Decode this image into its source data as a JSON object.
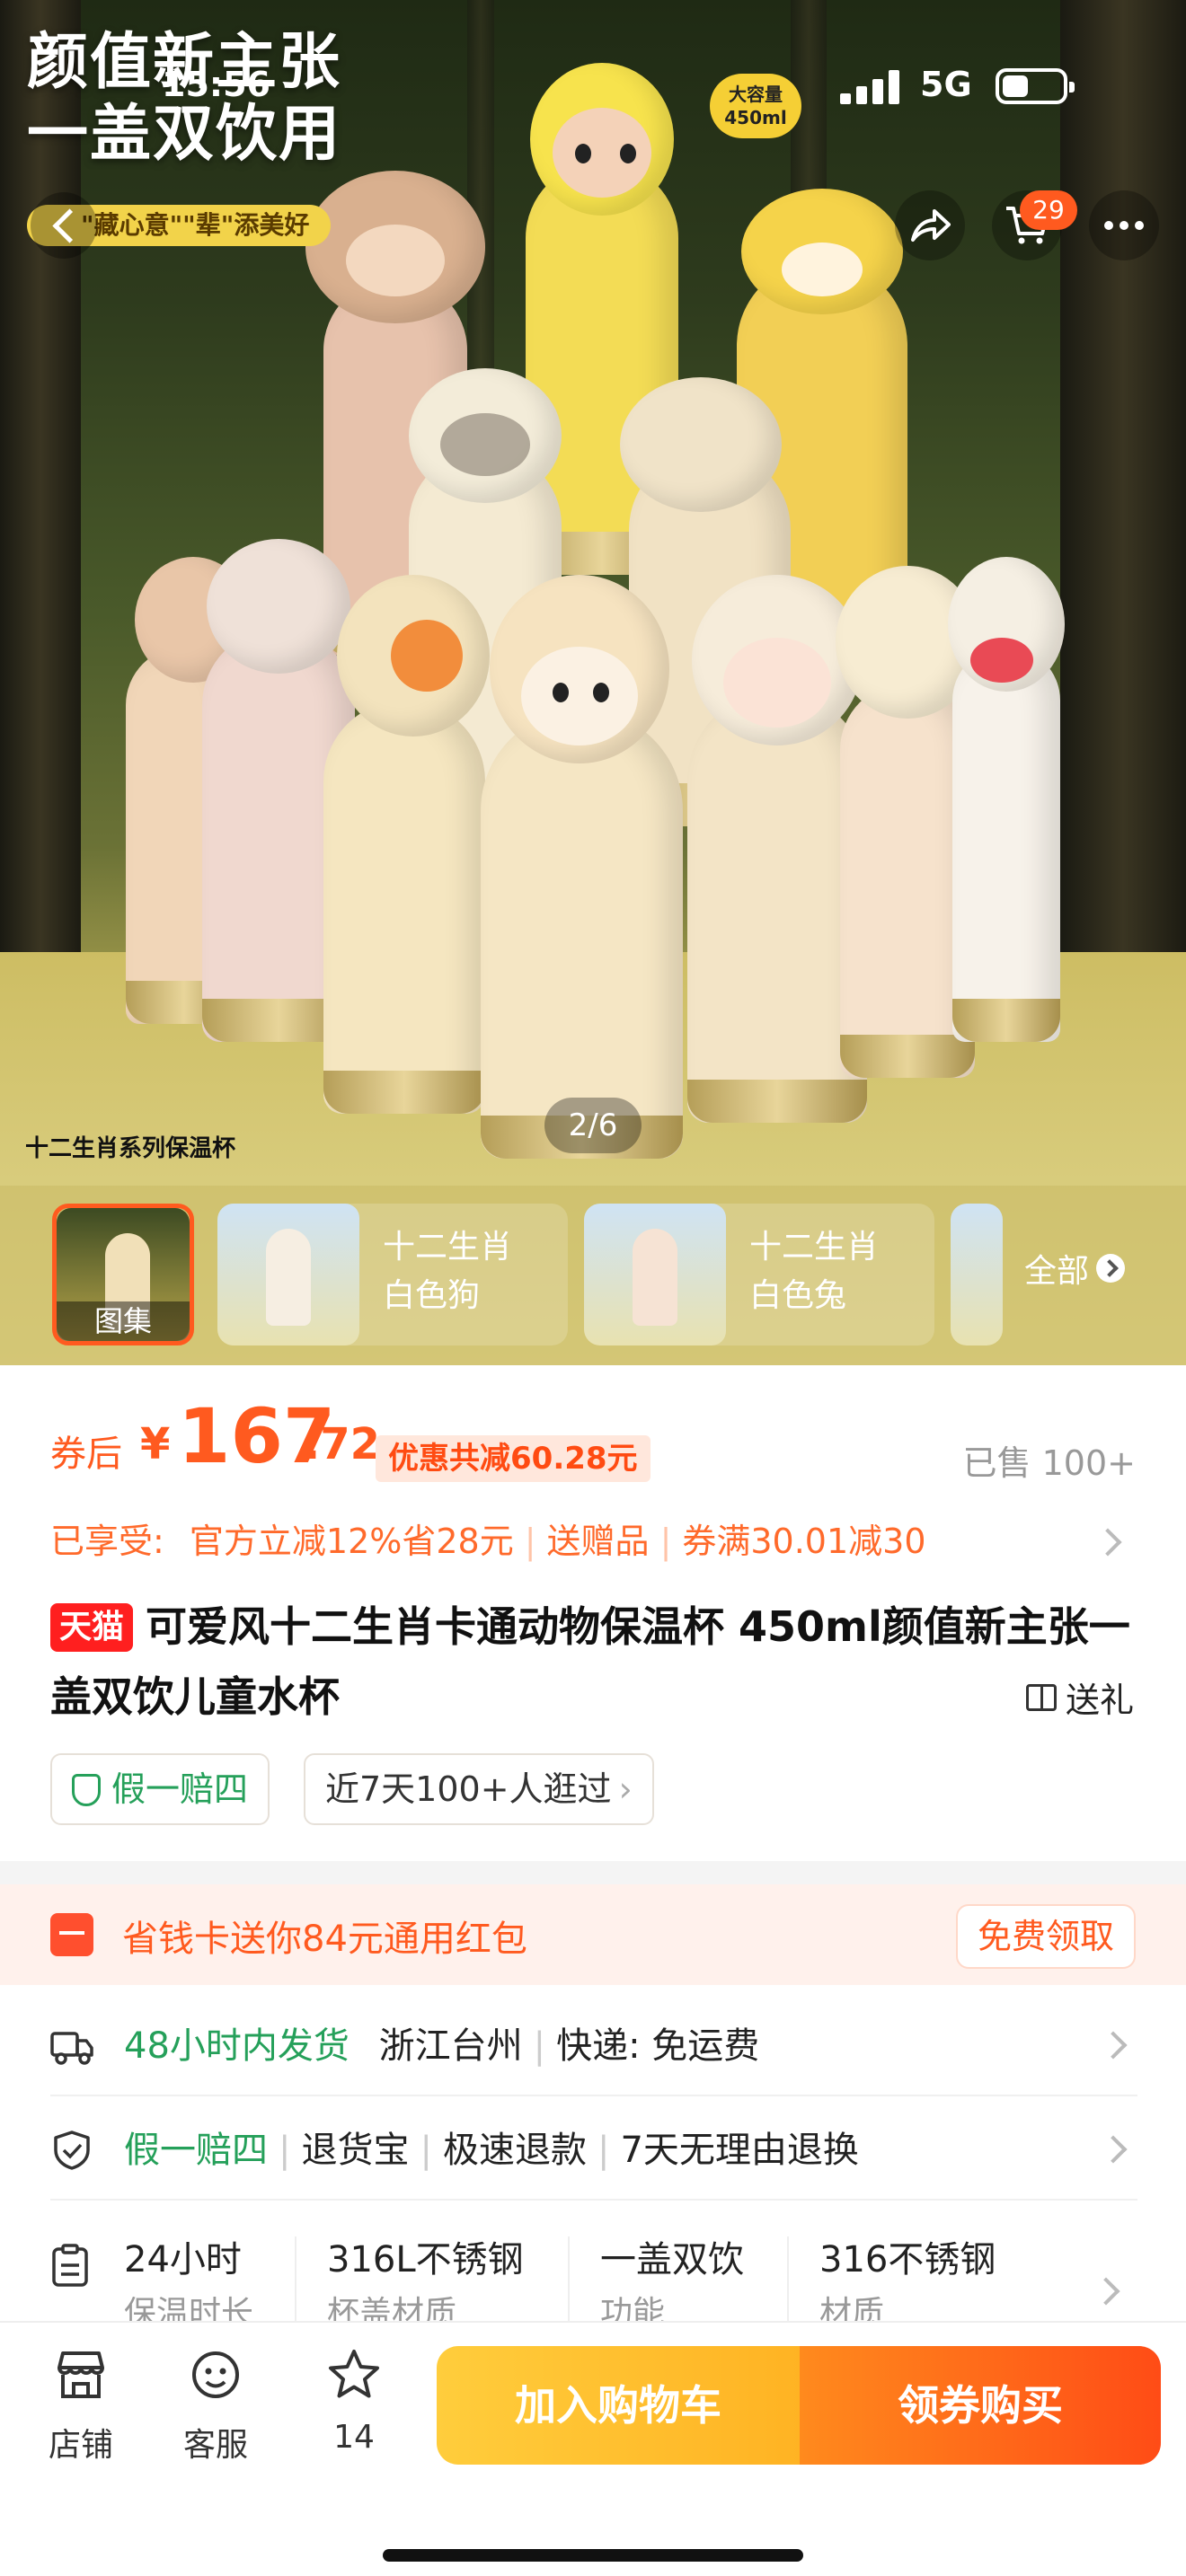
{
  "status_bar": {
    "time": "15:56",
    "network": "5G"
  },
  "hero": {
    "title_line1": "颜值新主张",
    "title_line2": "一盖双饮用",
    "slogan": "\"藏心意\"\"辈\"添美好",
    "capacity_badge_line1": "大容量",
    "capacity_badge_line2": "450ml",
    "footer_caption": "十二生肖系列保温杯",
    "pager": "2/6",
    "cart_count": "29"
  },
  "thumbnails": [
    {
      "label": "图集",
      "selected": true
    },
    {
      "line1": "十二生肖",
      "line2": "白色狗"
    },
    {
      "line1": "十二生肖",
      "line2": "白色兔"
    }
  ],
  "thumbnails_all_label": "全部",
  "price": {
    "label": "券后",
    "currency": "¥",
    "integer": "167",
    "decimal": ".72",
    "discount_tag": "优惠共减60.28元",
    "sold": "已售 100+"
  },
  "promo": {
    "prefix": "已享受:",
    "items": [
      "官方立减12%省28元",
      "送赠品",
      "券满30.01减30"
    ]
  },
  "product": {
    "tmall_badge": "天猫",
    "title": "可爱风十二生肖卡通动物保温杯 450ml颜值新主张一盖双饮儿童水杯",
    "gift_label": "送礼"
  },
  "tags": {
    "guarantee": "假一赔四",
    "views": "近7天100+人逛过"
  },
  "coupon_card": {
    "text": "省钱卡送你84元通用红包",
    "button": "免费领取"
  },
  "delivery": {
    "ship": "48小时内发货",
    "location": "浙江台州",
    "express": "快递: 免运费"
  },
  "service": {
    "items": [
      "假一赔四",
      "退货宝",
      "极速退款",
      "7天无理由退换"
    ]
  },
  "specs": [
    {
      "title": "24小时",
      "sub": "保温时长"
    },
    {
      "title": "316L不锈钢",
      "sub": "杯盖材质"
    },
    {
      "title": "一盖双饮",
      "sub": "功能"
    },
    {
      "title": "316不锈钢",
      "sub": "材质"
    }
  ],
  "bottom_bar": {
    "store": "店铺",
    "service": "客服",
    "favorites": "14",
    "add_to_cart": "加入购物车",
    "buy": "领券购买"
  },
  "colors": {
    "accent": "#ff5a1f",
    "guarantee_green": "#25a05a",
    "cta_yellow": "#ffb323",
    "cta_orange": "#ff4c16"
  }
}
